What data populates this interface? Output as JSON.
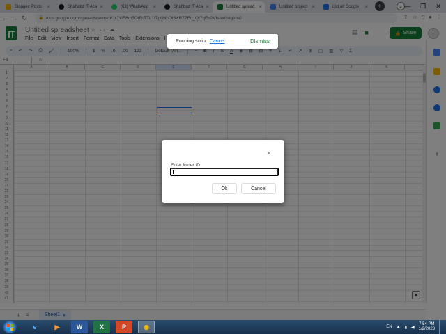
{
  "browser": {
    "tabs": [
      {
        "title": "Blogger: Posts",
        "color": "#f4b400"
      },
      {
        "title": "Shahabz IT Aca",
        "color": "#202124"
      },
      {
        "title": "(63) WhatsApp",
        "color": "#25d366"
      },
      {
        "title": "Shahbaz IT Aca",
        "color": "#202124"
      },
      {
        "title": "Untitled spread",
        "color": "#188038"
      },
      {
        "title": "Untitled project",
        "color": "#4285f4"
      },
      {
        "title": "List all Google",
        "color": "#1a73e8"
      }
    ],
    "new_tab": "+",
    "url": "docs.google.com/spreadsheets/d/1rJYiE6m5OfRtTTu1f7pljMhOl3XRZ7Fo_Qt7qEs2Vfs/edit#gid=0"
  },
  "docs": {
    "title": "Untitled spreadsheet",
    "menu": [
      "File",
      "Edit",
      "View",
      "Insert",
      "Format",
      "Data",
      "Tools",
      "Extensions",
      "Help"
    ],
    "share_label": "Share",
    "toolbar": {
      "zoom": "100%",
      "currency": "$",
      "percent": "%",
      "dec_less": ".0",
      "dec_more": ".00",
      "format_123": "123",
      "font": "Default (Ari..."
    },
    "name_box": "E6",
    "fx": "fx"
  },
  "grid": {
    "columns": [
      "A",
      "B",
      "C",
      "D",
      "E",
      "F",
      "G",
      "H",
      "I",
      "J",
      "K"
    ],
    "selected_column": "E",
    "rows": [
      "1",
      "2",
      "3",
      "4",
      "5",
      "6",
      "7",
      "8",
      "9",
      "10",
      "11",
      "12",
      "13",
      "14",
      "15",
      "16",
      "17",
      "18",
      "19",
      "20",
      "21",
      "22",
      "23",
      "24",
      "25",
      "26",
      "27",
      "28",
      "29",
      "30",
      "31",
      "32",
      "33",
      "34",
      "35",
      "36",
      "37",
      "38",
      "39",
      "40",
      "41"
    ]
  },
  "sheets": {
    "add": "+",
    "all_sheets": "≡",
    "active": "Sheet1"
  },
  "toast": {
    "message": "Running script",
    "cancel": "Cancel",
    "dismiss": "Dismiss"
  },
  "dialog": {
    "close": "×",
    "label": "Enter folder ID",
    "value": "",
    "ok": "Ok",
    "cancel": "Cancel"
  },
  "taskbar": {
    "apps": [
      "e",
      "▶",
      "W",
      "X",
      "P",
      "◉"
    ],
    "language": "EN",
    "time": "7:54 PM",
    "date": "1/2/2023"
  }
}
